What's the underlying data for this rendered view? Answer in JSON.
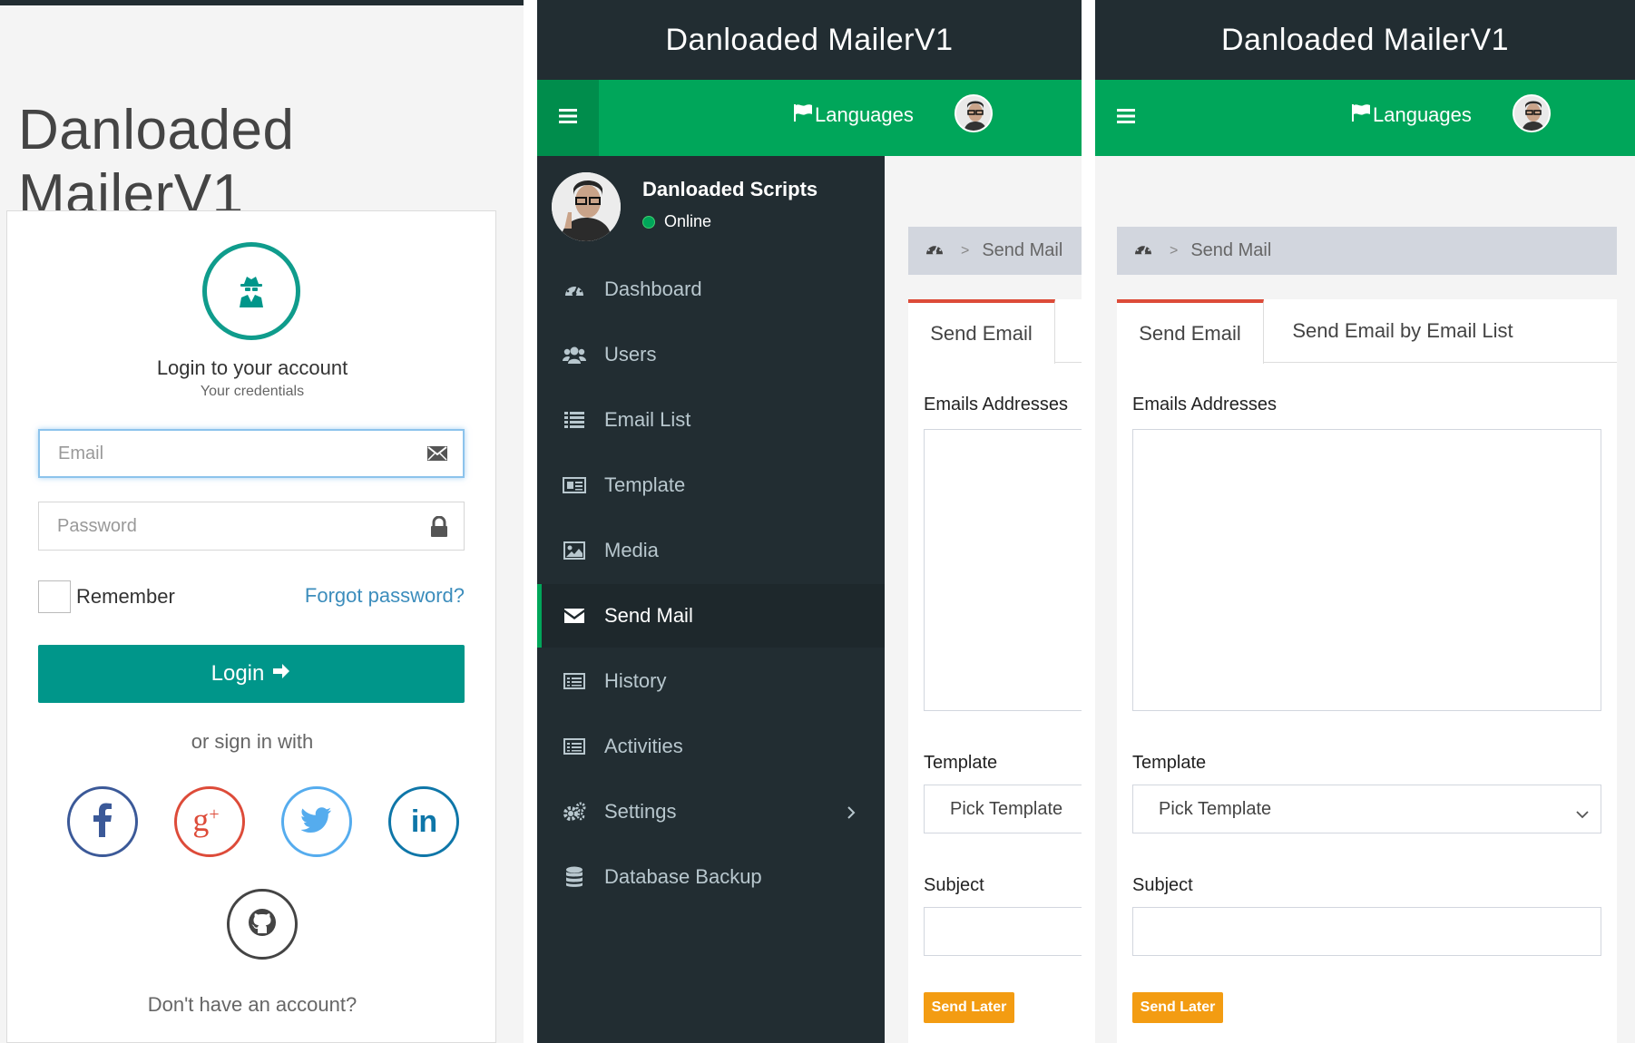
{
  "login": {
    "app_title": "Danloaded MailerV1",
    "heading": "Login to your account",
    "subheading": "Your credentials",
    "email_placeholder": "Email",
    "password_placeholder": "Password",
    "remember_label": "Remember",
    "forgot_link": "Forgot password?",
    "login_button": "Login",
    "or_sign_in": "or sign in with",
    "social": [
      {
        "name": "facebook-icon",
        "color": "#3b5998"
      },
      {
        "name": "google-plus-icon",
        "color": "#dd4b39"
      },
      {
        "name": "twitter-icon",
        "color": "#55acee"
      },
      {
        "name": "linkedin-icon",
        "color": "#0e76a8"
      },
      {
        "name": "github-icon",
        "color": "#444444"
      }
    ],
    "no_account": "Don't have an account?",
    "accent": "#00968a"
  },
  "header": {
    "app_title": "Danloaded MailerV1",
    "languages_label": "Languages",
    "header_color": "#222d32",
    "bar_color": "#00a65a"
  },
  "sidebar": {
    "user_name": "Danloaded Scripts",
    "status": "Online",
    "items": [
      {
        "label": "Dashboard",
        "icon": "dashboard-icon"
      },
      {
        "label": "Users",
        "icon": "users-icon"
      },
      {
        "label": "Email List",
        "icon": "list-icon"
      },
      {
        "label": "Template",
        "icon": "newspaper-icon"
      },
      {
        "label": "Media",
        "icon": "image-icon"
      },
      {
        "label": "Send Mail",
        "icon": "envelope-icon",
        "active": true
      },
      {
        "label": "History",
        "icon": "history-list-icon"
      },
      {
        "label": "Activities",
        "icon": "activities-list-icon"
      },
      {
        "label": "Settings",
        "icon": "cogs-icon",
        "has_submenu": true
      },
      {
        "label": "Database Backup",
        "icon": "database-icon"
      }
    ]
  },
  "send_mail": {
    "breadcrumb_current": "Send Mail",
    "breadcrumb_separator": ">",
    "tabs": [
      "Send Email",
      "Send Email by Email List"
    ],
    "emails_label": "Emails Addresses",
    "template_label": "Template",
    "template_selected": "Pick Template",
    "subject_label": "Subject",
    "send_later_button": "Send Later",
    "tab_accent": "#dd4b39",
    "button_color": "#f39c12"
  }
}
